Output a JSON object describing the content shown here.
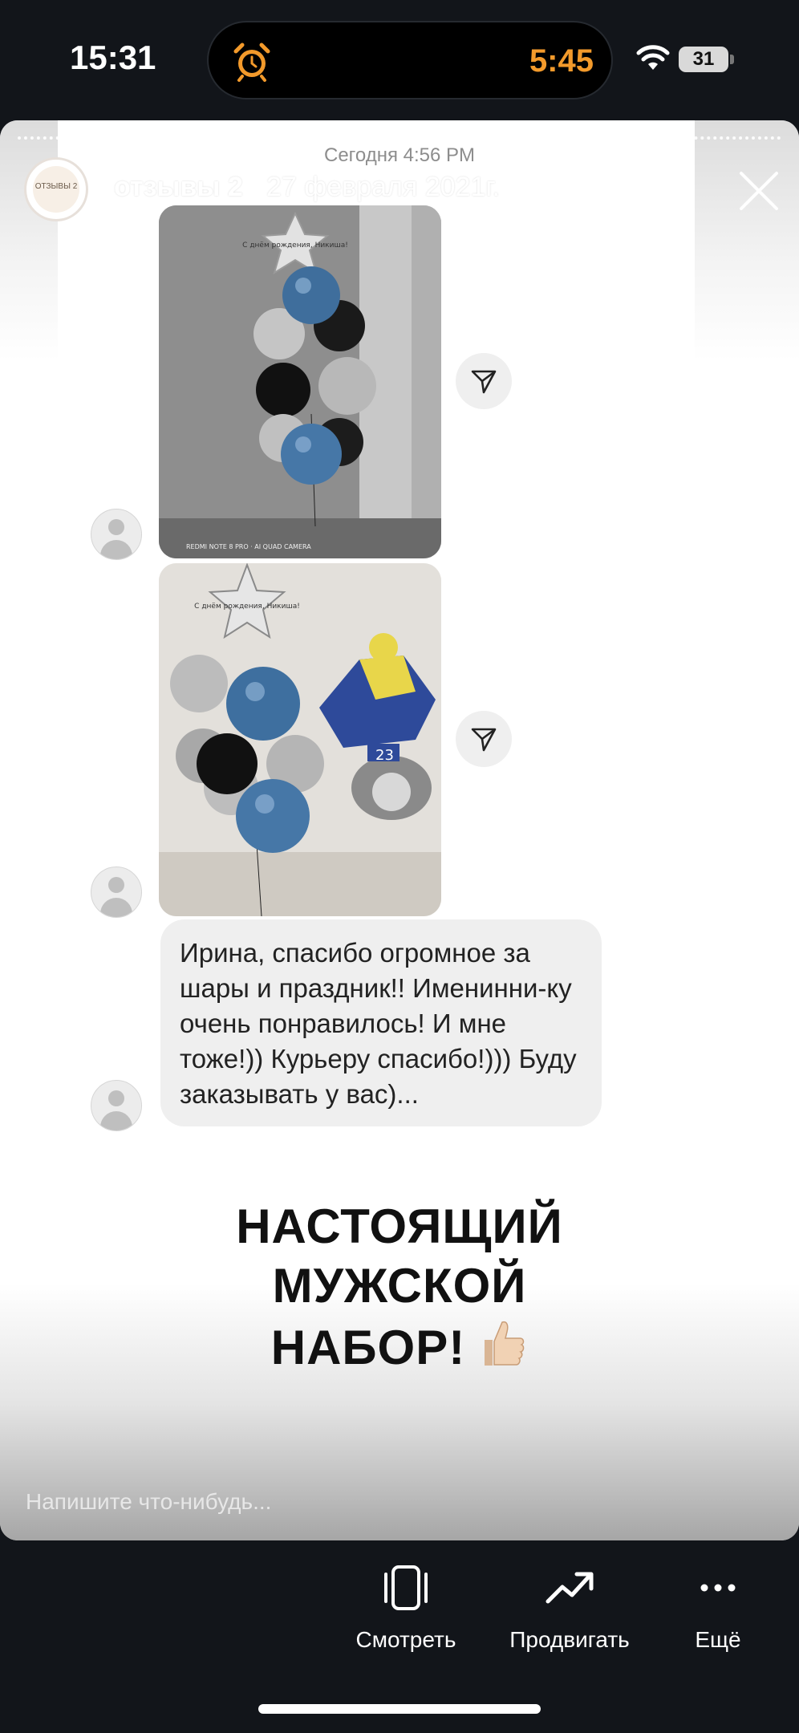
{
  "status_bar": {
    "time": "15:31",
    "timer": "5:45",
    "battery": "31"
  },
  "story": {
    "timestamp": "Сегодня 4:56 PM",
    "username": "отзывы 2",
    "date": "27 февраля 2021г.",
    "avatar_text": "ОТЗЫВЫ 2",
    "photo_caption": "REDMI NOTE 8 PRO · AI QUAD CAMERA",
    "balloon_text": "С днём рождения, Никиша!",
    "bike_number": "23",
    "message_text": "Ирина, спасибо огромное за шары и праздник!! Именинни-ку очень понравилось! И мне тоже!)) Курьеру спасибо!))) Буду заказывать у вас)...",
    "headline_line1": "НАСТОЯЩИЙ",
    "headline_line2": "МУЖСКОЙ",
    "headline_line3": "НАБОР!",
    "reply_placeholder": "Напишите что-нибудь..."
  },
  "bottom_actions": {
    "view_label": "Смотреть",
    "promote_label": "Продвигать",
    "more_label": "Ещё"
  },
  "colors": {
    "timer": "#f39a2b",
    "background": "#12151a",
    "bubble": "#efefef"
  },
  "icons": [
    "alarm-icon",
    "wifi-icon",
    "close-icon",
    "send-icon",
    "avatar-placeholder-icon",
    "thumbs-up-icon",
    "phone-view-icon",
    "trending-up-icon",
    "more-icon"
  ]
}
